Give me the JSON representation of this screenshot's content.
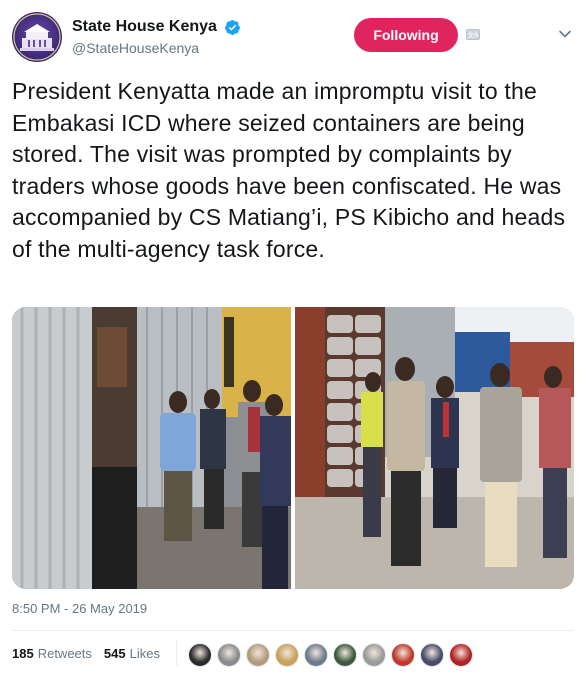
{
  "account": {
    "display_name": "State House Kenya",
    "handle": "@StateHouseKenya",
    "verified_icon": "verified-badge-icon"
  },
  "header": {
    "follow_label": "Following",
    "translate_icon": "translate-icon",
    "menu_icon": "chevron-down-icon"
  },
  "tweet": {
    "text": "President Kenyatta made an impromptu visit to the Embakasi ICD where seized containers are being stored. The visit was prompted by complaints by traders whose goods have been confiscated. He was accompanied by CS Matiang’i, PS Kibicho and heads of the multi-agency task force.",
    "timestamp": "8:50 PM - 26 May 2019"
  },
  "media": {
    "photos": [
      {
        "subject": "President and officials inspecting an open shipping container"
      },
      {
        "subject": "Officials standing before containers stacked with seized goods"
      }
    ]
  },
  "stats": {
    "retweets_count": "185",
    "retweets_label": "Retweets",
    "likes_count": "545",
    "likes_label": "Likes"
  },
  "likers": {
    "colors": [
      "#2b2b2b",
      "#8a8a8a",
      "#b39b7a",
      "#c9a15b",
      "#6b7a8c",
      "#3d5a3d",
      "#9a9a9a",
      "#c0392b",
      "#4a4a6a",
      "#b22222"
    ]
  },
  "colors": {
    "accent": "#e0245e",
    "verified": "#1da1f2",
    "muted": "#657786"
  }
}
